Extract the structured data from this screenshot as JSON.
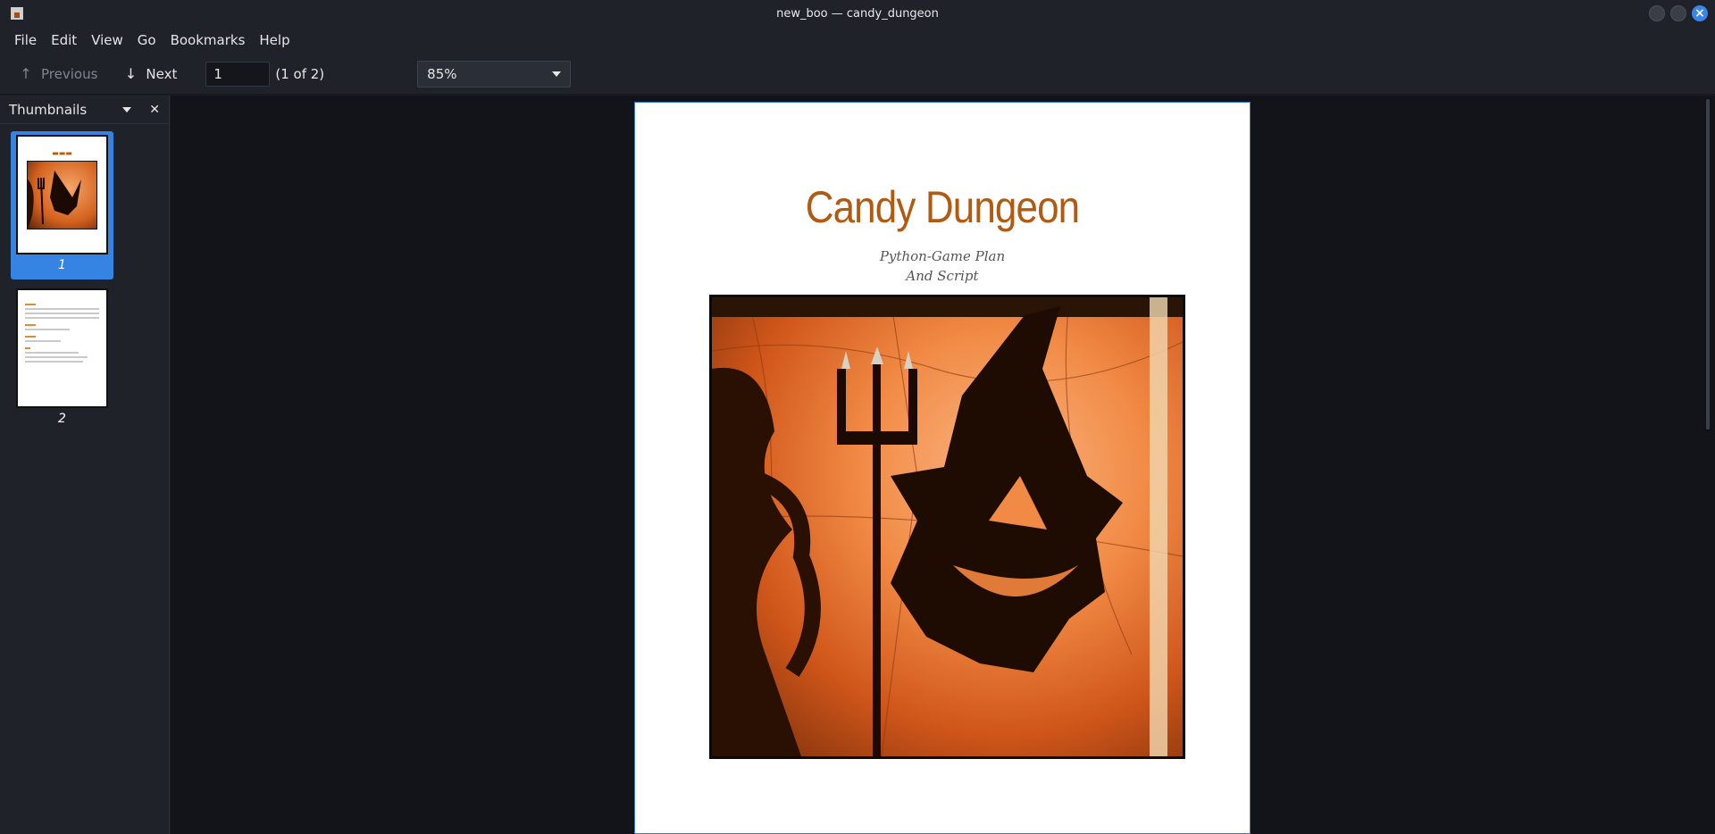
{
  "window": {
    "title": "new_boo — candy_dungeon"
  },
  "menubar": {
    "items": [
      "File",
      "Edit",
      "View",
      "Go",
      "Bookmarks",
      "Help"
    ]
  },
  "toolbar": {
    "previous_label": "Previous",
    "next_label": "Next",
    "page_value": "1",
    "page_count": "(1 of 2)",
    "zoom": "85%"
  },
  "sidebar": {
    "title": "Thumbnails",
    "thumbnails": [
      {
        "number": "1",
        "selected": true
      },
      {
        "number": "2",
        "selected": false
      }
    ]
  },
  "document": {
    "title": "Candy Dungeon",
    "subtitle_line1": "Python-Game Plan",
    "subtitle_line2": "And Script"
  },
  "colors": {
    "accent": "#3584e4",
    "title_orange": "#b15a12"
  }
}
